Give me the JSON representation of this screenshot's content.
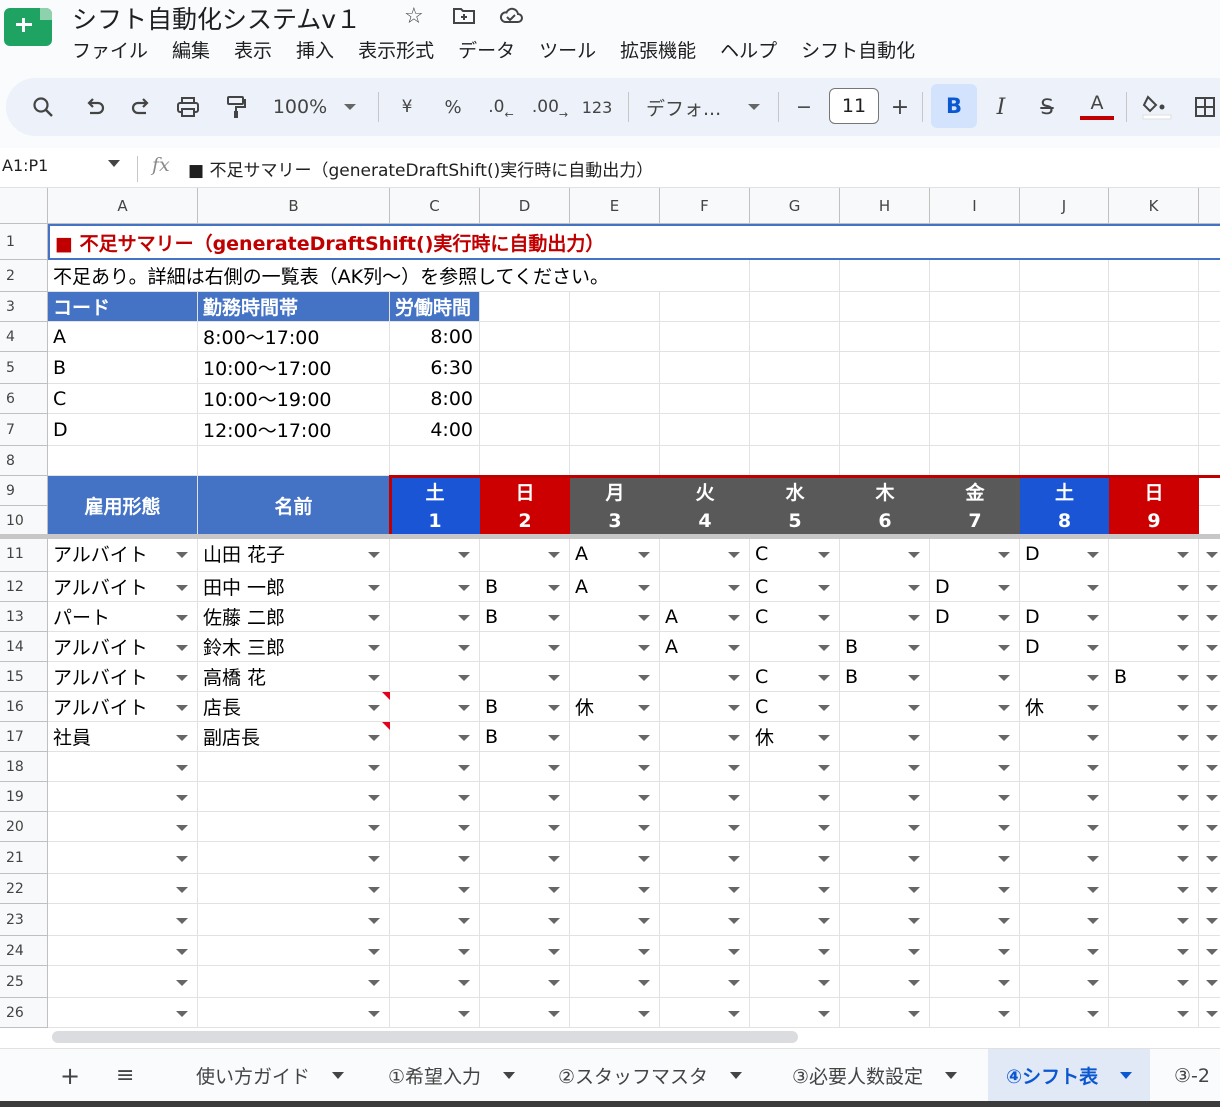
{
  "app": {
    "title": "シフト自動化システムv１",
    "menu": [
      "ファイル",
      "編集",
      "表示",
      "挿入",
      "表示形式",
      "データ",
      "ツール",
      "拡張機能",
      "ヘルプ",
      "シフト自動化"
    ]
  },
  "toolbar": {
    "zoom": "100%",
    "currency": "¥",
    "percent": "%",
    "dec_decrease": ".0",
    "dec_increase": ".00",
    "number_format": "123",
    "font": "デフォ...",
    "minus": "−",
    "font_size": "11",
    "plus": "+",
    "bold": "B",
    "italic": "I",
    "strike": "S",
    "text_color": "A"
  },
  "formula_bar": {
    "name_box": "A1:P1",
    "fx": "fx",
    "formula": "■ 不足サマリー（generateDraftShift()実行時に自動出力）"
  },
  "grid": {
    "columns": [
      "A",
      "B",
      "C",
      "D",
      "E",
      "F",
      "G",
      "H",
      "I",
      "J",
      "K"
    ],
    "rows": [
      "1",
      "2",
      "3",
      "4",
      "5",
      "6",
      "7",
      "8",
      "9",
      "10",
      "11",
      "12",
      "13",
      "14",
      "15",
      "16",
      "17",
      "18",
      "19",
      "20",
      "21",
      "22",
      "23",
      "24",
      "25",
      "26"
    ],
    "summary_title": "■ 不足サマリー（generateDraftShift()実行時に自動出力）",
    "summary_message": "不足あり。詳細は右側の一覧表（AK列〜）を参照してください。",
    "code_table": {
      "headers": [
        "コード",
        "勤務時間帯",
        "労働時間"
      ],
      "rows": [
        [
          "A",
          "8:00〜17:00",
          "8:00"
        ],
        [
          "B",
          "10:00〜17:00",
          "6:30"
        ],
        [
          "C",
          "10:00〜19:00",
          "8:00"
        ],
        [
          "D",
          "12:00〜17:00",
          "4:00"
        ]
      ]
    },
    "shift_header": {
      "employment": "雇用形態",
      "name": "名前",
      "days": [
        {
          "dow": "土",
          "date": "1",
          "color": "#1a55d6"
        },
        {
          "dow": "日",
          "date": "2",
          "color": "#cc0000"
        },
        {
          "dow": "月",
          "date": "3",
          "color": "#595959"
        },
        {
          "dow": "火",
          "date": "4",
          "color": "#595959"
        },
        {
          "dow": "水",
          "date": "5",
          "color": "#595959"
        },
        {
          "dow": "木",
          "date": "6",
          "color": "#595959"
        },
        {
          "dow": "金",
          "date": "7",
          "color": "#595959"
        },
        {
          "dow": "土",
          "date": "8",
          "color": "#1a55d6"
        },
        {
          "dow": "日",
          "date": "9",
          "color": "#cc0000"
        }
      ]
    },
    "staff": [
      {
        "type": "アルバイト",
        "name": "山田 花子",
        "shifts": [
          "",
          "",
          "A",
          "",
          "C",
          "",
          "",
          "D",
          ""
        ]
      },
      {
        "type": "アルバイト",
        "name": "田中 一郎",
        "shifts": [
          "",
          "B",
          "A",
          "",
          "C",
          "",
          "D",
          "",
          ""
        ]
      },
      {
        "type": "パート",
        "name": "佐藤 二郎",
        "shifts": [
          "",
          "B",
          "",
          "A",
          "C",
          "",
          "D",
          "D",
          ""
        ]
      },
      {
        "type": "アルバイト",
        "name": "鈴木 三郎",
        "shifts": [
          "",
          "",
          "",
          "A",
          "",
          "B",
          "",
          "D",
          ""
        ]
      },
      {
        "type": "アルバイト",
        "name": "高橋 花",
        "shifts": [
          "",
          "",
          "",
          "",
          "C",
          "B",
          "",
          "",
          "B"
        ]
      },
      {
        "type": "アルバイト",
        "name": "店長",
        "shifts": [
          "",
          "B",
          "休",
          "",
          "C",
          "",
          "",
          "休",
          ""
        ],
        "note": true
      },
      {
        "type": "社員",
        "name": "副店長",
        "shifts": [
          "",
          "B",
          "",
          "",
          "休",
          "",
          "",
          "",
          ""
        ],
        "note": true
      }
    ]
  },
  "sheet_tabs": {
    "add": "+",
    "list": "≡",
    "tabs": [
      "使い方ガイド",
      "①希望入力",
      "②スタッフマスタ",
      "③必要人数設定",
      "④シフト表",
      "③-2"
    ],
    "active_index": 4
  },
  "colors": {
    "accent": "#0b57d0",
    "header_blue": "#4472c4",
    "summary_red": "#c00000",
    "sheets_green": "#1ea362"
  }
}
